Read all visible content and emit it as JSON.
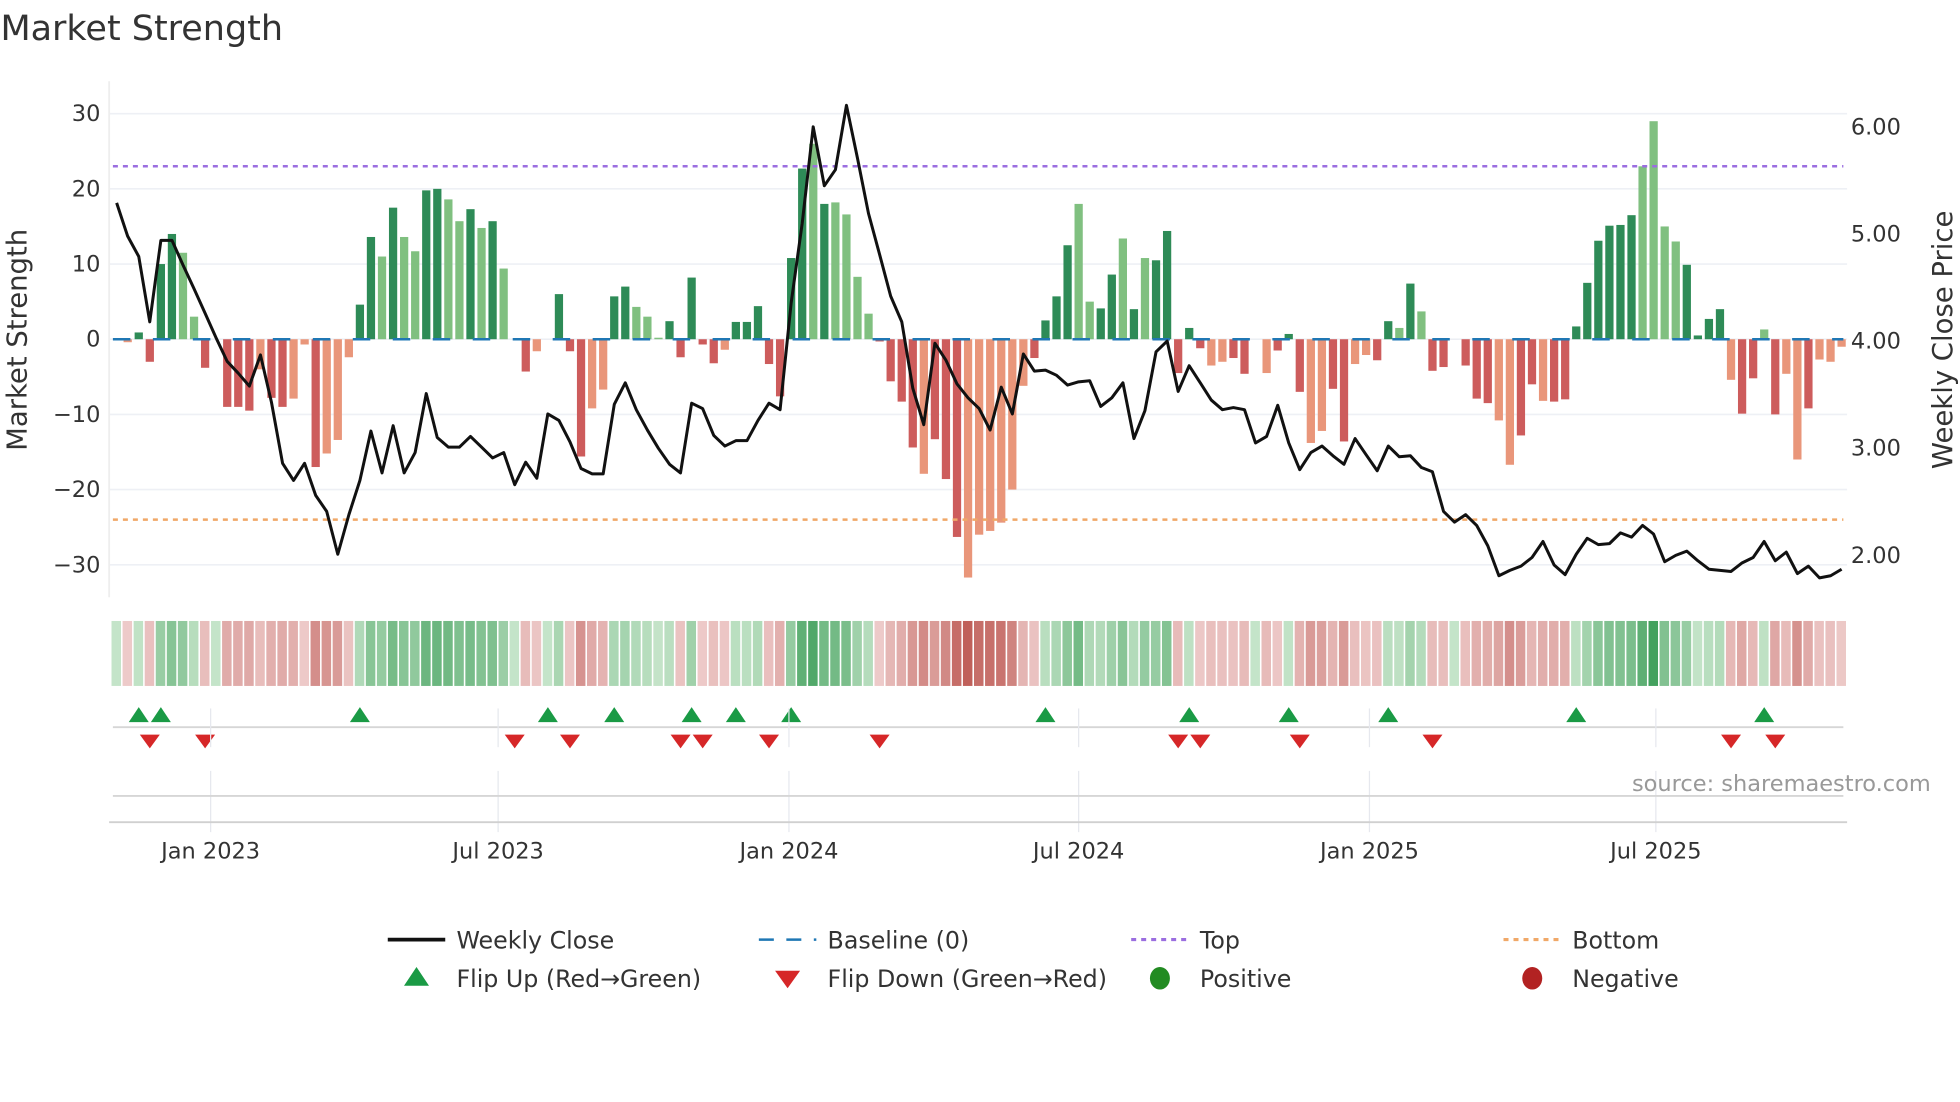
{
  "chart_data": {
    "type": "bar",
    "title": "Market Strength",
    "ylabel": "Market Strength",
    "ylabel_right": "Weekly Close Price",
    "ylim": [
      -35,
      35
    ],
    "ylim_right": [
      1.7,
      6.3
    ],
    "yticks": [
      "30",
      "20",
      "10",
      "0",
      "−10",
      "−20",
      "−30"
    ],
    "ytick_values": [
      30,
      20,
      10,
      0,
      -10,
      -20,
      -30
    ],
    "yticks_right": [
      "6.00",
      "5.00",
      "4.00",
      "3.00",
      "2.00"
    ],
    "ytick_right_values": [
      6,
      5,
      4,
      3,
      2
    ],
    "x_unit": "week index",
    "x_ticks": [
      {
        "label": "Jan 2023",
        "week": 8.5
      },
      {
        "label": "Jul 2023",
        "week": 34.5
      },
      {
        "label": "Jan 2024",
        "week": 60.8
      },
      {
        "label": "Jul 2024",
        "week": 87
      },
      {
        "label": "Jan 2025",
        "week": 113.3
      },
      {
        "label": "Jul 2025",
        "week": 139.2
      }
    ],
    "top_level": 23,
    "bottom_level": -24,
    "baseline": 0,
    "strength": [
      0,
      -0.4,
      0.9,
      -3,
      10,
      14,
      11.5,
      3,
      -3.8,
      0,
      -9,
      -9,
      -9.5,
      -4,
      -7.8,
      -9,
      -7.9,
      -0.7,
      -17,
      -15.2,
      -13.4,
      -2.4,
      4.6,
      13.6,
      11,
      17.5,
      13.6,
      11.7,
      19.8,
      20,
      18.6,
      15.7,
      17.3,
      14.8,
      15.7,
      9.4,
      0,
      -4.3,
      -1.6,
      0,
      6,
      -1.6,
      -15.6,
      -9.2,
      -6.7,
      5.7,
      7,
      4.3,
      3,
      0.2,
      2.4,
      -2.4,
      8.2,
      -0.7,
      -3.2,
      -1.4,
      2.3,
      2.3,
      4.4,
      -3.3,
      -7.6,
      10.8,
      22.7,
      26,
      18,
      18.2,
      16.6,
      8.3,
      3.4,
      -0.3,
      -5.6,
      -8.3,
      -14.4,
      -17.9,
      -13.3,
      -18.6,
      -26.3,
      -31.7,
      -26,
      -25.5,
      -24.4,
      -20,
      -6.2,
      -2.5,
      2.5,
      5.7,
      12.5,
      18,
      5,
      4.1,
      8.6,
      13.4,
      4,
      10.8,
      10.5,
      14.4,
      -4.5,
      1.5,
      -1.2,
      -3.5,
      -3,
      -2.5,
      -4.6,
      0,
      -4.5,
      -1.5,
      0.7,
      -7,
      -13.8,
      -12.2,
      -6.6,
      -13.6,
      -3.3,
      -2.1,
      -2.8,
      2.4,
      1.5,
      7.4,
      3.7,
      -4.2,
      -3.7,
      0,
      -3.5,
      -7.9,
      -8.5,
      -10.8,
      -16.7,
      -12.8,
      -6,
      -8.2,
      -8.3,
      -8,
      1.7,
      7.5,
      13.1,
      15.1,
      15.2,
      16.5,
      23,
      29,
      15,
      13,
      9.9,
      0.5,
      2.7,
      4,
      -5.4,
      -9.9,
      -5.2,
      1.3,
      -10,
      -4.6,
      -16,
      -9.2,
      -2.7,
      -3,
      -1
    ],
    "shade": "DLDDDDLLDDDDDLDDLLDLLLDDLDLLDDLLDLDLDDLDDDDLLDDLLLDDDDDLDDDDDDDLDLLLLDDDDLDDDLLLLLLDDDDLLDDLDLDDDDDLLDDLLDDDLLDDLLDDLDLDDDDDDLLDDLDDDDDDDDLLLLDDDDLDDLDLLDL",
    "weekly_close": [
      5.29,
      4.98,
      4.79,
      4.18,
      4.94,
      4.94,
      4.71,
      4.49,
      4.26,
      4.03,
      3.81,
      3.7,
      3.58,
      3.87,
      3.43,
      2.86,
      2.7,
      2.86,
      2.56,
      2.41,
      2.01,
      2.38,
      2.7,
      3.16,
      2.77,
      3.21,
      2.77,
      2.96,
      3.51,
      3.1,
      3.01,
      3.01,
      3.11,
      3.01,
      2.91,
      2.96,
      2.66,
      2.87,
      2.72,
      3.32,
      3.26,
      3.06,
      2.81,
      2.76,
      2.76,
      3.41,
      3.61,
      3.36,
      3.17,
      3.0,
      2.85,
      2.77,
      3.42,
      3.37,
      3.12,
      3.02,
      3.07,
      3.07,
      3.26,
      3.42,
      3.36,
      4.36,
      5.1,
      6.0,
      5.45,
      5.6,
      6.2,
      5.71,
      5.19,
      4.81,
      4.42,
      4.18,
      3.56,
      3.22,
      3.98,
      3.82,
      3.6,
      3.47,
      3.37,
      3.17,
      3.57,
      3.32,
      3.88,
      3.72,
      3.73,
      3.68,
      3.59,
      3.62,
      3.63,
      3.39,
      3.47,
      3.61,
      3.09,
      3.35,
      3.9,
      4.0,
      3.53,
      3.77,
      3.61,
      3.45,
      3.36,
      3.38,
      3.36,
      3.05,
      3.11,
      3.4,
      3.05,
      2.8,
      2.96,
      3.02,
      2.93,
      2.85,
      3.09,
      2.94,
      2.79,
      3.02,
      2.92,
      2.93,
      2.82,
      2.78,
      2.41,
      2.31,
      2.38,
      2.28,
      2.09,
      1.81,
      1.86,
      1.9,
      1.98,
      2.13,
      1.91,
      1.82,
      2.01,
      2.16,
      2.1,
      2.11,
      2.21,
      2.17,
      2.28,
      2.2,
      1.94,
      2.0,
      2.04,
      1.95,
      1.87,
      1.86,
      1.85,
      1.93,
      1.98,
      2.13,
      1.95,
      2.03,
      1.83,
      1.9,
      1.79,
      1.81,
      1.87
    ],
    "flip_up_weeks": [
      2,
      4,
      22,
      39,
      45,
      52,
      56,
      61,
      84,
      97,
      106,
      115,
      132,
      149
    ],
    "flip_down_weeks": [
      3,
      8,
      36,
      41,
      51,
      53,
      59,
      69,
      96,
      98,
      107,
      119,
      146,
      150
    ],
    "source": "source: sharemaestro.com",
    "legend": [
      {
        "label": "Weekly Close",
        "kind": "line",
        "color": "#111111"
      },
      {
        "label": "Baseline (0)",
        "kind": "dash",
        "color": "#1f77b4"
      },
      {
        "label": "Top",
        "kind": "dot",
        "color": "#9b6ee0"
      },
      {
        "label": "Bottom",
        "kind": "dot",
        "color": "#f0a868"
      },
      {
        "label": "Flip Up (Red→Green)",
        "kind": "tri-up",
        "color": "#1a9a45"
      },
      {
        "label": "Flip Down (Green→Red)",
        "kind": "tri-down",
        "color": "#d62728"
      },
      {
        "label": "Positive",
        "kind": "circle",
        "color": "#228b22"
      },
      {
        "label": "Negative",
        "kind": "circle",
        "color": "#b22222"
      }
    ],
    "colors": {
      "pos_dark": "#2e8b57",
      "pos_light": "#80c080",
      "neg_dark": "#cd5c5c",
      "neg_light": "#e9967a",
      "line": "#111111",
      "baseline": "#1f77b4",
      "top": "#9b6ee0",
      "bottom": "#f0a868"
    }
  }
}
